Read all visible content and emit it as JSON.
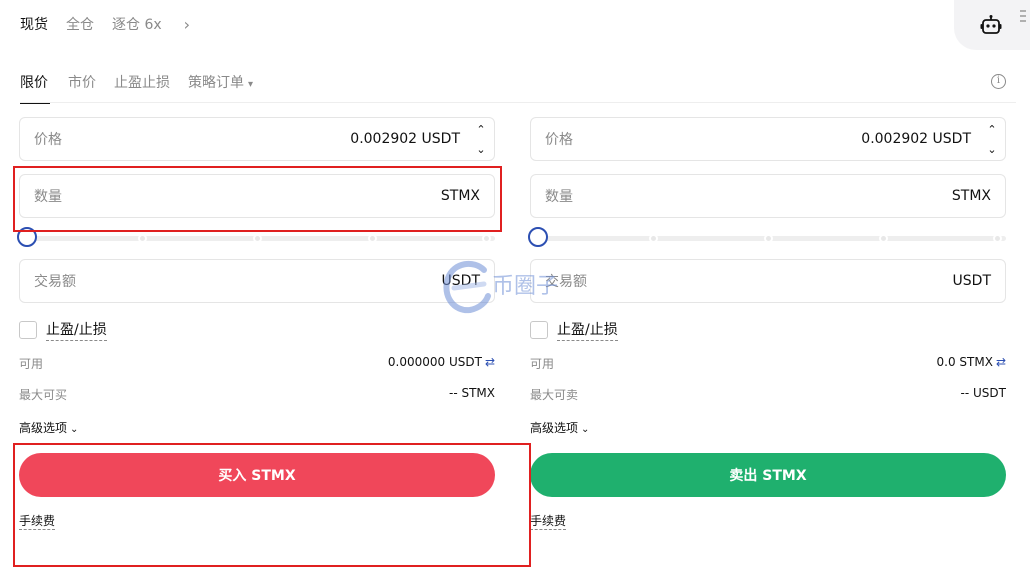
{
  "top_tabs": {
    "spot": "现货",
    "cross": "全仓",
    "isolated": "逐仓 6x",
    "more": "›"
  },
  "order_tabs": {
    "limit": "限价",
    "market": "市价",
    "tp_sl": "止盈止损",
    "strategy": "策略订单",
    "caret": "▾",
    "info": "i"
  },
  "buy": {
    "price_label": "价格",
    "price_value": "0.002902 USDT",
    "qty_label": "数量",
    "qty_unit": "STMX",
    "amount_label": "交易额",
    "amount_unit": "USDT",
    "tpsl_label": "止盈/止损",
    "available_label": "可用",
    "available_value": "0.000000 USDT",
    "swap": "⇄",
    "max_label": "最大可买",
    "max_value": "-- STMX",
    "advanced_label": "高级选项",
    "advanced_chevron": "⌄",
    "button_label": "买入 STMX",
    "fee_label": "手续费"
  },
  "sell": {
    "price_label": "价格",
    "price_value": "0.002902 USDT",
    "qty_label": "数量",
    "qty_unit": "STMX",
    "amount_label": "交易额",
    "amount_unit": "USDT",
    "tpsl_label": "止盈/止损",
    "available_label": "可用",
    "available_value": "0.0 STMX",
    "swap": "⇄",
    "max_label": "最大可卖",
    "max_value": "-- USDT",
    "advanced_label": "高级选项",
    "advanced_chevron": "⌄",
    "button_label": "卖出 STMX",
    "fee_label": "手续费"
  },
  "stepper": {
    "up": "⌃",
    "down": "⌄"
  },
  "watermark": {
    "text": "币圈子"
  },
  "slider": {
    "buy_level": 0,
    "sell_level": 0
  },
  "colors": {
    "buy": "#f0475a",
    "sell": "#1fb06e",
    "accent": "#2c4fb2",
    "highlight": "#e02020"
  }
}
